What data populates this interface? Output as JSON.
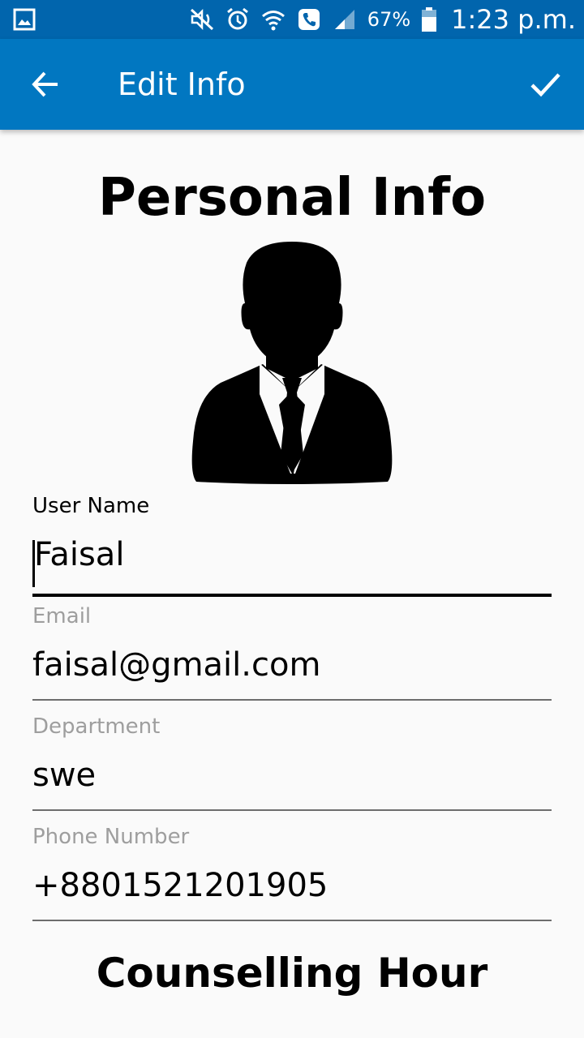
{
  "status_bar": {
    "battery": "67%",
    "time": "1:23 p.m.",
    "icons": [
      "gallery-icon",
      "mute-icon",
      "alarm-icon",
      "wifi-icon",
      "phone-icon",
      "signal-icon",
      "battery-icon"
    ]
  },
  "app_bar": {
    "title": "Edit Info",
    "back_icon": "arrow-back-icon",
    "done_icon": "check-icon"
  },
  "main": {
    "personal_title": "Personal Info",
    "avatar_icon": "person-suit-avatar",
    "counselling_title": "Counselling Hour"
  },
  "form": {
    "user_name": {
      "label": "User Name",
      "value": "Faisal"
    },
    "email": {
      "label": "Email",
      "value": "faisal@gmail.com"
    },
    "department": {
      "label": "Department",
      "value": "swe"
    },
    "phone": {
      "label": "Phone Number",
      "value": "+8801521201905"
    }
  },
  "colors": {
    "status_bar": "#0165ad",
    "app_bar": "#0177c1",
    "background": "#fafafa",
    "label_inactive": "#9e9e9e"
  }
}
